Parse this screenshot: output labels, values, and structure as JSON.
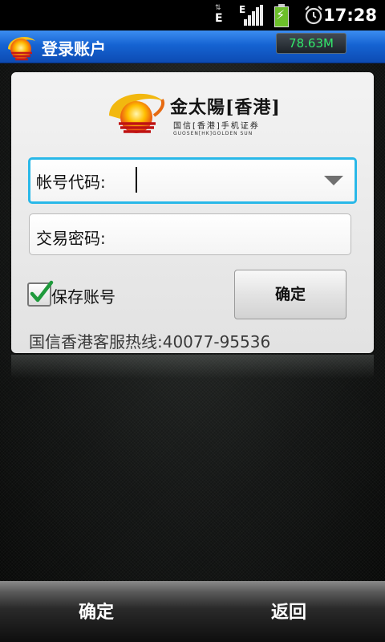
{
  "status_bar": {
    "network_type_1": "E",
    "network_type_2": "E",
    "time": "17:28"
  },
  "title_bar": {
    "title": "登录账户",
    "memory_usage": "78.63M"
  },
  "brand": {
    "name": "金太陽[香港]",
    "subtitle": "国信[香港]手机证券",
    "english": "GUOSEN[HK]GOLDEN SUN"
  },
  "login_form": {
    "account_label": "帐号代码:",
    "account_value": "",
    "password_label": "交易密码:",
    "password_value": "",
    "remember_label": "保存账号",
    "remember_checked": true,
    "confirm_label": "确定",
    "hotline": "国信香港客服热线:40077-95536"
  },
  "bottom_bar": {
    "confirm_label": "确定",
    "back_label": "返回"
  },
  "colors": {
    "title_bar": "#1563d2",
    "focus_border": "#29b8e8",
    "memory_text": "#32e86b",
    "check_mark": "#1f9a3c"
  }
}
